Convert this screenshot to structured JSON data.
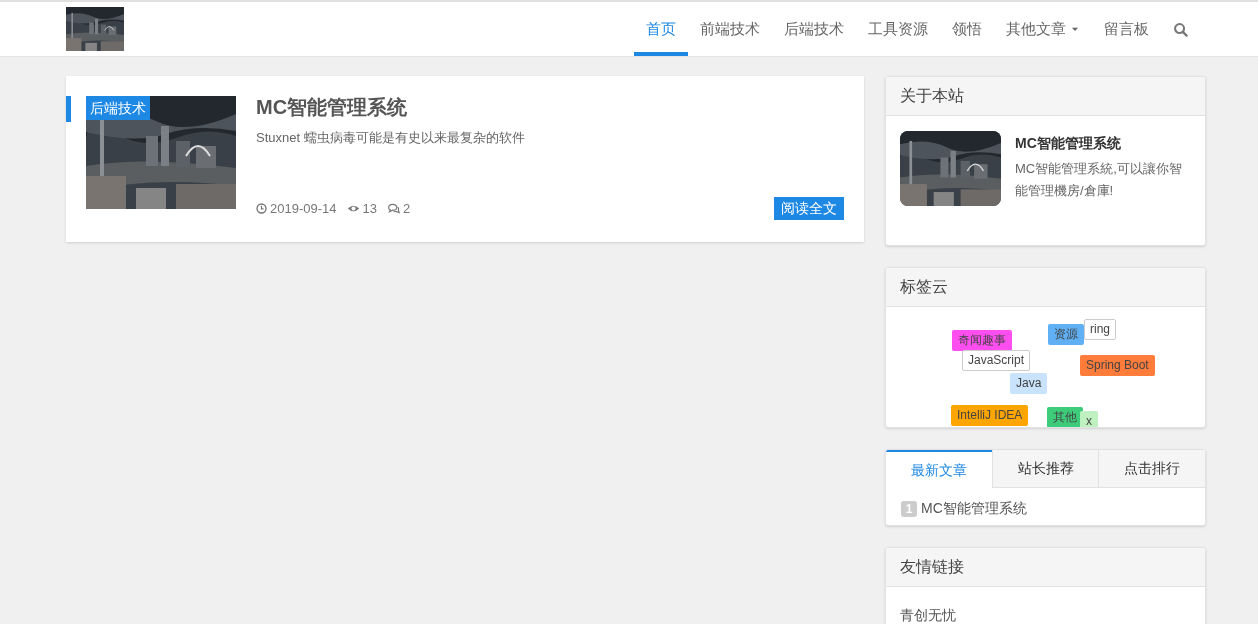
{
  "header": {
    "nav": [
      {
        "label": "首页",
        "selected": true,
        "dropdown": false
      },
      {
        "label": "前端技术",
        "selected": false,
        "dropdown": false
      },
      {
        "label": "后端技术",
        "selected": false,
        "dropdown": false
      },
      {
        "label": "工具资源",
        "selected": false,
        "dropdown": false
      },
      {
        "label": "领悟",
        "selected": false,
        "dropdown": false
      },
      {
        "label": "其他文章",
        "selected": false,
        "dropdown": true
      },
      {
        "label": "留言板",
        "selected": false,
        "dropdown": false
      }
    ]
  },
  "articles": [
    {
      "category": "后端技术",
      "title": "MC智能管理系统",
      "summary": "Stuxnet 蠕虫病毒可能是有史以来最复杂的软件",
      "date": "2019-09-14",
      "views": "13",
      "comments": "2",
      "button": "阅读全文"
    }
  ],
  "sidebar": {
    "about": {
      "title": "关于本站",
      "name": "MC智能管理系统",
      "description": "MC智能管理系統,可以讓你智能管理機房/倉庫!"
    },
    "tag_cloud": {
      "title": "标签云",
      "tags": [
        {
          "label": "ring",
          "color": "#ffffff"
        },
        {
          "label": "资源",
          "color": "#5fb0f5"
        },
        {
          "label": "奇闻趣事",
          "color": "#ff4ef0"
        },
        {
          "label": "JavaScript",
          "color": "#ffffff"
        },
        {
          "label": "Spring Boot",
          "color": "#ff7c3a"
        },
        {
          "label": "Java",
          "color": "#c8e3fb"
        },
        {
          "label": "IntelliJ IDEA",
          "color": "#ffa500"
        },
        {
          "label": "其他",
          "color": "#3dcc7a"
        },
        {
          "label": "x",
          "color": "#bff0c0"
        }
      ]
    },
    "tabs": {
      "tabs": [
        {
          "label": "最新文章",
          "selected": true
        },
        {
          "label": "站长推荐",
          "selected": false
        },
        {
          "label": "点击排行",
          "selected": false
        }
      ],
      "items": [
        {
          "rank": "1",
          "title": "MC智能管理系统"
        }
      ]
    },
    "links": {
      "title": "友情链接",
      "items": [
        "青创无忧"
      ]
    }
  }
}
